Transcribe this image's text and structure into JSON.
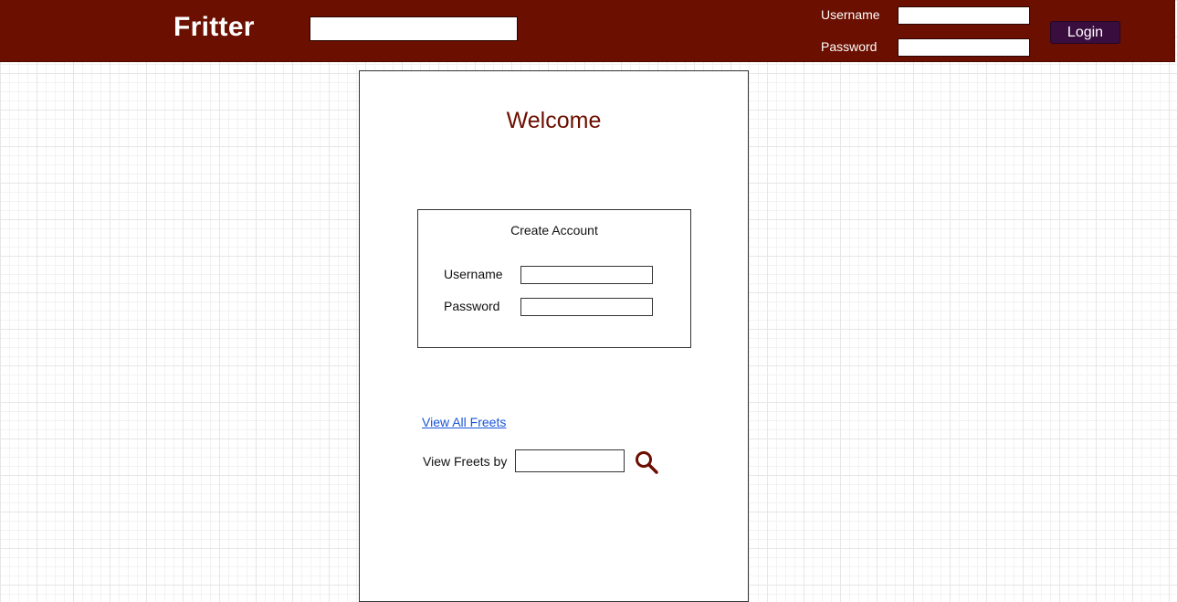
{
  "header": {
    "logo": "Fritter",
    "search": {
      "value": "",
      "placeholder": ""
    },
    "login": {
      "username_label": "Username",
      "username_value": "",
      "password_label": "Password",
      "password_value": "",
      "button_label": "Login"
    }
  },
  "main": {
    "welcome": "Welcome",
    "create_account": {
      "title": "Create Account",
      "username_label": "Username",
      "username_value": "",
      "password_label": "Password",
      "password_value": ""
    },
    "view_all_link": "View All Freets",
    "view_by": {
      "label": "View Freets by",
      "value": "",
      "search_icon": "search-icon"
    }
  },
  "colors": {
    "header_bg": "#6b0f00",
    "accent": "#6b0f00",
    "login_button": "#3a0d3f",
    "link": "#1a55d8"
  }
}
